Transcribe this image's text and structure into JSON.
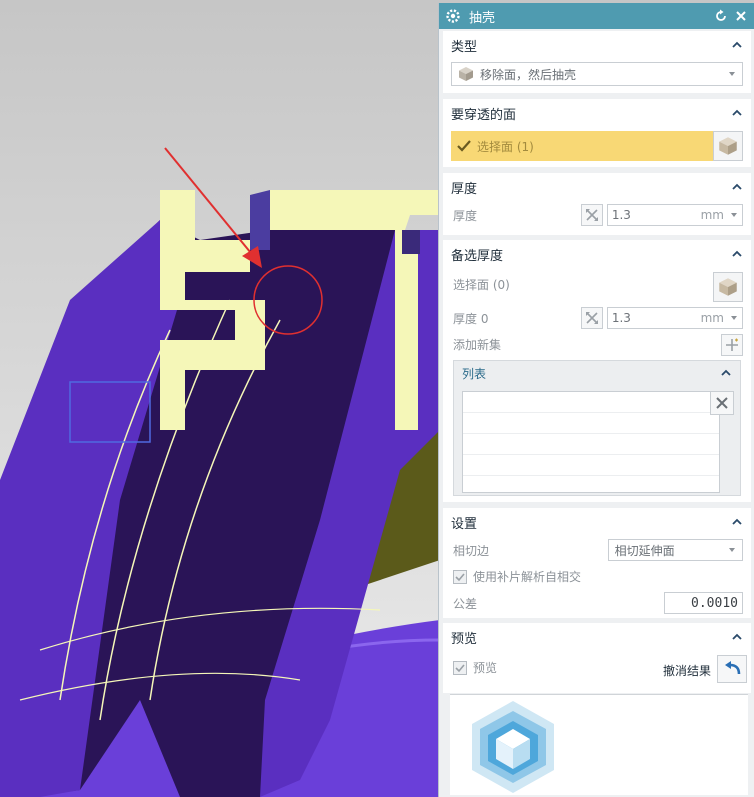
{
  "dialog": {
    "title": "抽壳",
    "type_group": {
      "label": "类型",
      "dropdown_value": "移除面，然后抽壳"
    },
    "pierce_group": {
      "label": "要穿透的面",
      "select_face": "选择面 (1)"
    },
    "thickness_group": {
      "label": "厚度",
      "field_label": "厚度",
      "value": "1.3",
      "unit": "mm"
    },
    "alt_thickness_group": {
      "label": "备选厚度",
      "select_face": "选择面 (0)",
      "field_label": "厚度 0",
      "value": "1.3",
      "unit": "mm",
      "add_new_set": "添加新集",
      "list_label": "列表"
    },
    "settings_group": {
      "label": "设置",
      "tangent_edge_label": "相切边",
      "tangent_edge_value": "相切延伸面",
      "patch_checkbox_label": "使用补片解析自相交",
      "tolerance_label": "公差",
      "tolerance_value": "0.0010"
    },
    "preview_group": {
      "label": "预览",
      "preview_checkbox_label": "预览",
      "undo_result_label": "撤消结果"
    }
  },
  "colors": {
    "titlebar": "#4f9bb0",
    "selection_highlight": "#f8d875",
    "model_dark": "#2a1457",
    "model_purple": "#6a3fd9",
    "model_yellow": "#f5f7b8",
    "model_olive": "#5b5a1a",
    "annotation_red": "#e03030"
  }
}
